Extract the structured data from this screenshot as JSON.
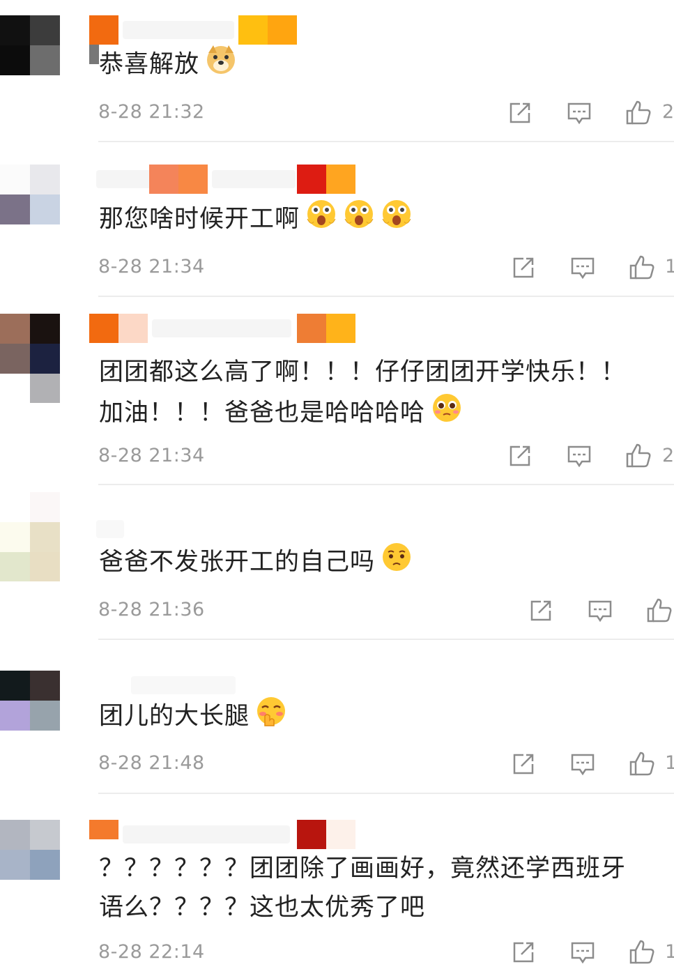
{
  "colors": {
    "text": "#222222",
    "meta": "#9a9a9a",
    "divider": "#ececec",
    "icon": "#8c8c8c"
  },
  "comments": [
    {
      "text_lines": [
        "恭喜解放"
      ],
      "emojis": [
        "doge-emoji"
      ],
      "timestamp": "8-28 21:32",
      "like_count": "2"
    },
    {
      "text_lines": [
        "那您啥时候开工啊"
      ],
      "emojis": [
        "shocked-emoji",
        "shocked-emoji",
        "shocked-emoji"
      ],
      "timestamp": "8-28 21:34",
      "like_count": "1"
    },
    {
      "text_lines": [
        "团团都这么高了啊！！！仔仔团团开学快乐！！",
        "加油！！！爸爸也是哈哈哈哈"
      ],
      "emojis": [
        "pleading-emoji"
      ],
      "timestamp": "8-28 21:34",
      "like_count": "2"
    },
    {
      "text_lines": [
        "爸爸不发张开工的自己吗"
      ],
      "emojis": [
        "sad-emoji"
      ],
      "timestamp": "8-28 21:36",
      "like_count": ""
    },
    {
      "text_lines": [
        "团儿的大长腿"
      ],
      "emojis": [
        "shy-emoji"
      ],
      "timestamp": "8-28 21:48",
      "like_count": "1"
    },
    {
      "text_lines": [
        "？？？？？？团团除了画画好，竟然还学西班牙",
        "语么？？？？这也太优秀了吧"
      ],
      "emojis": [],
      "timestamp": "8-28 22:14",
      "like_count": "1"
    }
  ]
}
